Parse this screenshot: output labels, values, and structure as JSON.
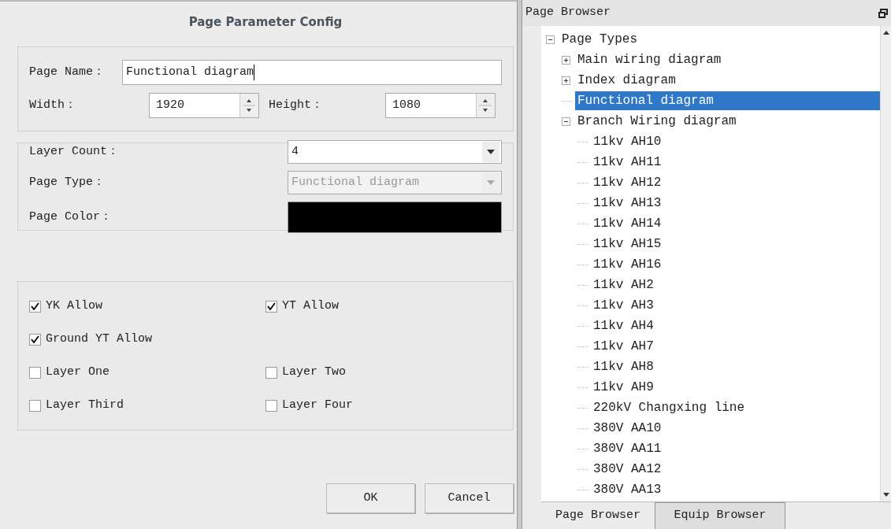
{
  "dialog": {
    "title": "Page Parameter Config",
    "page_name": {
      "label": "Page Name：",
      "value": "Functional diagram"
    },
    "width": {
      "label": "Width：",
      "value": "1920"
    },
    "height": {
      "label": "Height：",
      "value": "1080"
    },
    "layer_count": {
      "label": "Layer Count：",
      "value": "4",
      "disabled": false
    },
    "page_type": {
      "label": "Page Type：",
      "value": "Functional diagram",
      "disabled": true
    },
    "page_color": {
      "label": "Page Color：",
      "color": "#000000"
    },
    "checkbox_rows": [
      [
        {
          "label": "YK Allow",
          "checked": true
        },
        {
          "label": "YT Allow",
          "checked": true
        }
      ],
      [
        {
          "label": "Ground YT Allow",
          "checked": true
        }
      ],
      [
        {
          "label": "Layer One",
          "checked": false
        },
        {
          "label": "Layer Two",
          "checked": false
        }
      ],
      [
        {
          "label": "Layer Third",
          "checked": false
        },
        {
          "label": "Layer Four",
          "checked": false
        }
      ]
    ],
    "buttons": [
      "OK",
      "Cancel"
    ]
  },
  "browser": {
    "title": "Page Browser",
    "tree": [
      {
        "label": "Page Types",
        "expanded": true,
        "selected": false,
        "children": [
          {
            "label": "Main wiring diagram",
            "expanded": false,
            "selected": false
          },
          {
            "label": "Index diagram",
            "expanded": false,
            "selected": false
          },
          {
            "label": "Functional diagram",
            "selected": true
          },
          {
            "label": "Branch Wiring diagram",
            "expanded": true,
            "selected": false,
            "children": [
              {
                "label": "11kv AH10",
                "selected": false
              },
              {
                "label": "11kv AH11",
                "selected": false
              },
              {
                "label": "11kv AH12",
                "selected": false
              },
              {
                "label": "11kv AH13",
                "selected": false
              },
              {
                "label": "11kv AH14",
                "selected": false
              },
              {
                "label": "11kv AH15",
                "selected": false
              },
              {
                "label": "11kv AH16",
                "selected": false
              },
              {
                "label": "11kv AH2",
                "selected": false
              },
              {
                "label": "11kv AH3",
                "selected": false
              },
              {
                "label": "11kv AH4",
                "selected": false
              },
              {
                "label": "11kv AH7",
                "selected": false
              },
              {
                "label": "11kv AH8",
                "selected": false
              },
              {
                "label": "11kv AH9",
                "selected": false
              },
              {
                "label": "220kV Changxing line",
                "selected": false
              },
              {
                "label": "380V AA10",
                "selected": false
              },
              {
                "label": "380V AA11",
                "selected": false
              },
              {
                "label": "380V AA12",
                "selected": false
              },
              {
                "label": "380V AA13",
                "selected": false
              }
            ]
          }
        ]
      }
    ],
    "tabs": [
      {
        "label": "Page Browser",
        "selected": true
      },
      {
        "label": "Equip Browser",
        "selected": false
      }
    ]
  }
}
